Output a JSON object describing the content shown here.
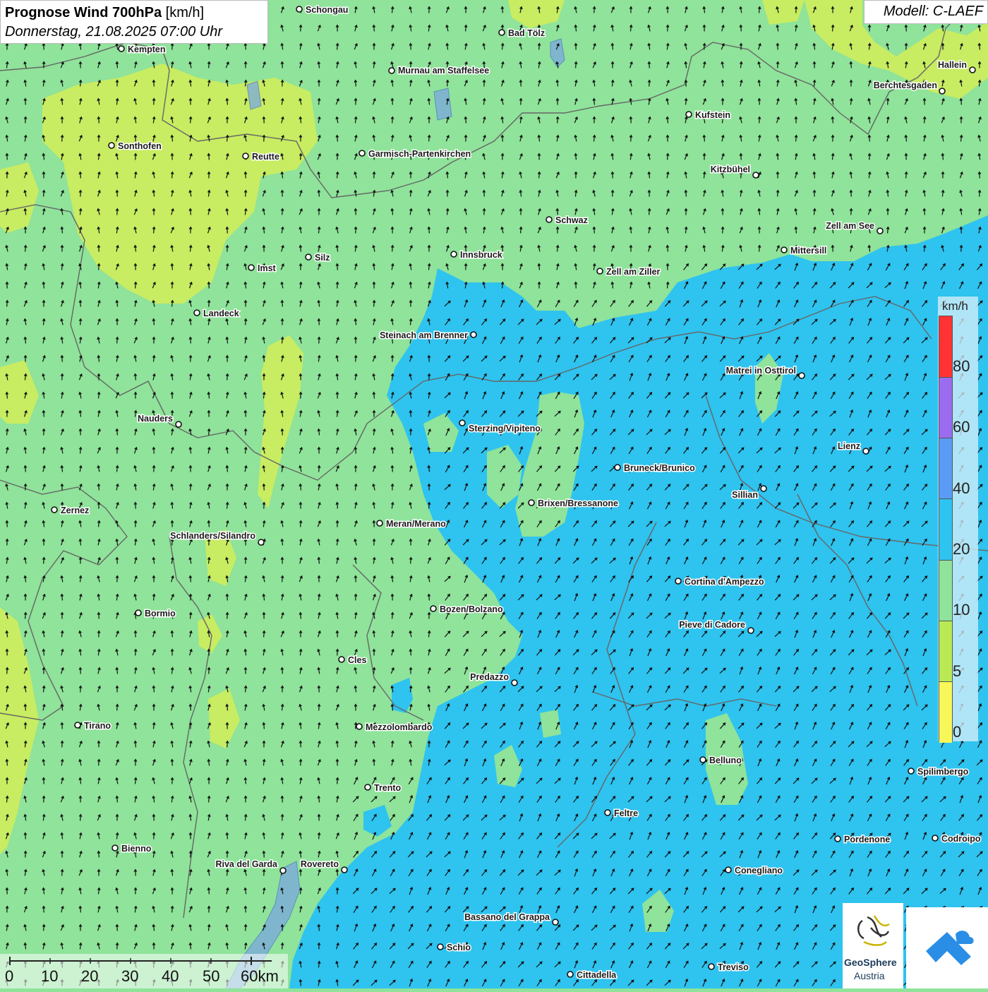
{
  "title": {
    "main": "Prognose Wind 700hPa",
    "unit": "[km/h]",
    "date": "Donnerstag, 21.08.2025 07:00 Uhr"
  },
  "model": "Modell: C-LAEF",
  "legend": {
    "unit": "km/h",
    "ticks": [
      "80",
      "60",
      "40",
      "20",
      "10",
      "5",
      "0"
    ],
    "colors": [
      "#ff3333",
      "#9b6cf0",
      "#5a9cf5",
      "#2fc3ef",
      "#8fe39a",
      "#b9ea55",
      "#f7f75a"
    ]
  },
  "scale_bar": {
    "labels": [
      "0",
      "10",
      "20",
      "30",
      "40",
      "50",
      "60km"
    ]
  },
  "logo": {
    "name1": "GeoSphere",
    "name2": "Austria"
  },
  "colors": {
    "zone_green": "#8fe39a",
    "zone_blue": "#2fc3ef",
    "zone_yellow": "#c8ec62",
    "border": "#666666"
  },
  "places": [
    {
      "name": "Schongau"
    },
    {
      "name": "Bad Tölz"
    },
    {
      "name": "Kempten"
    },
    {
      "name": "Murnau am Staffelsee"
    },
    {
      "name": "Hallein"
    },
    {
      "name": "Berchtesgaden"
    },
    {
      "name": "Kufstein"
    },
    {
      "name": "Sonthofen"
    },
    {
      "name": "Reutte"
    },
    {
      "name": "Garmisch-Partenkirchen"
    },
    {
      "name": "Kitzbühel"
    },
    {
      "name": "Schwaz"
    },
    {
      "name": "Zell am See"
    },
    {
      "name": "Innsbruck"
    },
    {
      "name": "Mittersill"
    },
    {
      "name": "Imst"
    },
    {
      "name": "Silz"
    },
    {
      "name": "Zell am Ziller"
    },
    {
      "name": "Landeck"
    },
    {
      "name": "Steinach am Brenner"
    },
    {
      "name": "Matrei in Osttirol"
    },
    {
      "name": "Nauders"
    },
    {
      "name": "Sterzing/Vipiteno"
    },
    {
      "name": "Lienz"
    },
    {
      "name": "Bruneck/Brunico"
    },
    {
      "name": "Sillian"
    },
    {
      "name": "Zernez"
    },
    {
      "name": "Brixen/Bressanone"
    },
    {
      "name": "Meran/Merano"
    },
    {
      "name": "Schlanders/Silandro"
    },
    {
      "name": "Cortina d'Ampezzo"
    },
    {
      "name": "Bozen/Bolzano"
    },
    {
      "name": "Bormio"
    },
    {
      "name": "Pieve di Cadore"
    },
    {
      "name": "Cles"
    },
    {
      "name": "Predazzo"
    },
    {
      "name": "Tirano"
    },
    {
      "name": "Mezzolombardo"
    },
    {
      "name": "Belluno"
    },
    {
      "name": "Spilimbergo"
    },
    {
      "name": "Trento"
    },
    {
      "name": "Feltre"
    },
    {
      "name": "Pordenone"
    },
    {
      "name": "Codroipo"
    },
    {
      "name": "Bienno"
    },
    {
      "name": "Riva del Garda"
    },
    {
      "name": "Rovereto"
    },
    {
      "name": "Conegliano"
    },
    {
      "name": "Bassano del Grappa"
    },
    {
      "name": "Schio"
    },
    {
      "name": "Treviso"
    },
    {
      "name": "Cittadella"
    }
  ]
}
